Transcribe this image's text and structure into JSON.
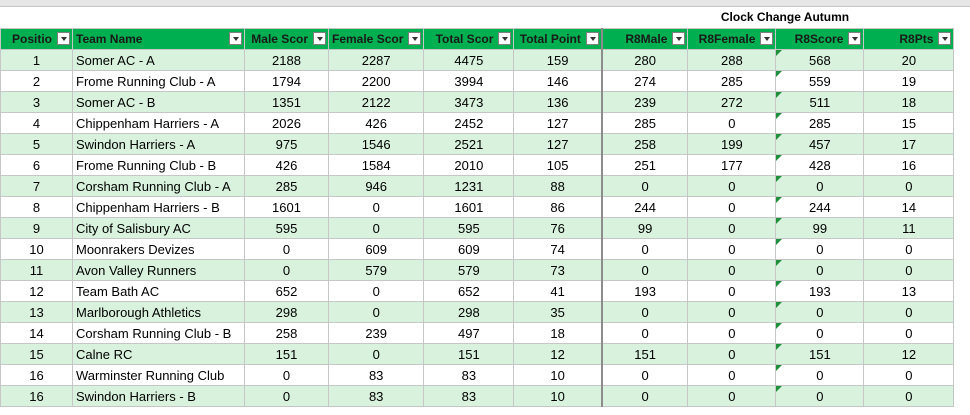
{
  "group_title": "Clock Change Autumn",
  "headers": [
    "Positio",
    "Team Name",
    "Male Scor",
    "Female Scor",
    "Total Scor",
    "Total Point",
    "R8Male",
    "R8Female",
    "R8Score",
    "R8Pts"
  ],
  "rows": [
    [
      "1",
      "Somer AC - A",
      "2188",
      "2287",
      "4475",
      "159",
      "280",
      "288",
      "568",
      "20"
    ],
    [
      "2",
      "Frome Running Club - A",
      "1794",
      "2200",
      "3994",
      "146",
      "274",
      "285",
      "559",
      "19"
    ],
    [
      "3",
      "Somer AC - B",
      "1351",
      "2122",
      "3473",
      "136",
      "239",
      "272",
      "511",
      "18"
    ],
    [
      "4",
      "Chippenham Harriers - A",
      "2026",
      "426",
      "2452",
      "127",
      "285",
      "0",
      "285",
      "15"
    ],
    [
      "5",
      "Swindon Harriers - A",
      "975",
      "1546",
      "2521",
      "127",
      "258",
      "199",
      "457",
      "17"
    ],
    [
      "6",
      "Frome Running Club - B",
      "426",
      "1584",
      "2010",
      "105",
      "251",
      "177",
      "428",
      "16"
    ],
    [
      "7",
      "Corsham Running Club - A",
      "285",
      "946",
      "1231",
      "88",
      "0",
      "0",
      "0",
      "0"
    ],
    [
      "8",
      "Chippenham Harriers - B",
      "1601",
      "0",
      "1601",
      "86",
      "244",
      "0",
      "244",
      "14"
    ],
    [
      "9",
      "City of Salisbury AC",
      "595",
      "0",
      "595",
      "76",
      "99",
      "0",
      "99",
      "11"
    ],
    [
      "10",
      "Moonrakers Devizes",
      "0",
      "609",
      "609",
      "74",
      "0",
      "0",
      "0",
      "0"
    ],
    [
      "11",
      "Avon Valley Runners",
      "0",
      "579",
      "579",
      "73",
      "0",
      "0",
      "0",
      "0"
    ],
    [
      "12",
      "Team Bath AC",
      "652",
      "0",
      "652",
      "41",
      "193",
      "0",
      "193",
      "13"
    ],
    [
      "13",
      "Marlborough Athletics",
      "298",
      "0",
      "298",
      "35",
      "0",
      "0",
      "0",
      "0"
    ],
    [
      "14",
      "Corsham Running Club - B",
      "258",
      "239",
      "497",
      "18",
      "0",
      "0",
      "0",
      "0"
    ],
    [
      "15",
      "Calne RC",
      "151",
      "0",
      "151",
      "12",
      "151",
      "0",
      "151",
      "12"
    ],
    [
      "16",
      "Warminster Running Club",
      "0",
      "83",
      "83",
      "10",
      "0",
      "0",
      "0",
      "0"
    ],
    [
      "16",
      "Swindon Harriers - B",
      "0",
      "83",
      "83",
      "10",
      "0",
      "0",
      "0",
      "0"
    ]
  ],
  "colors": {
    "header_green": "#00b050",
    "band_green": "#d9f2dd"
  }
}
